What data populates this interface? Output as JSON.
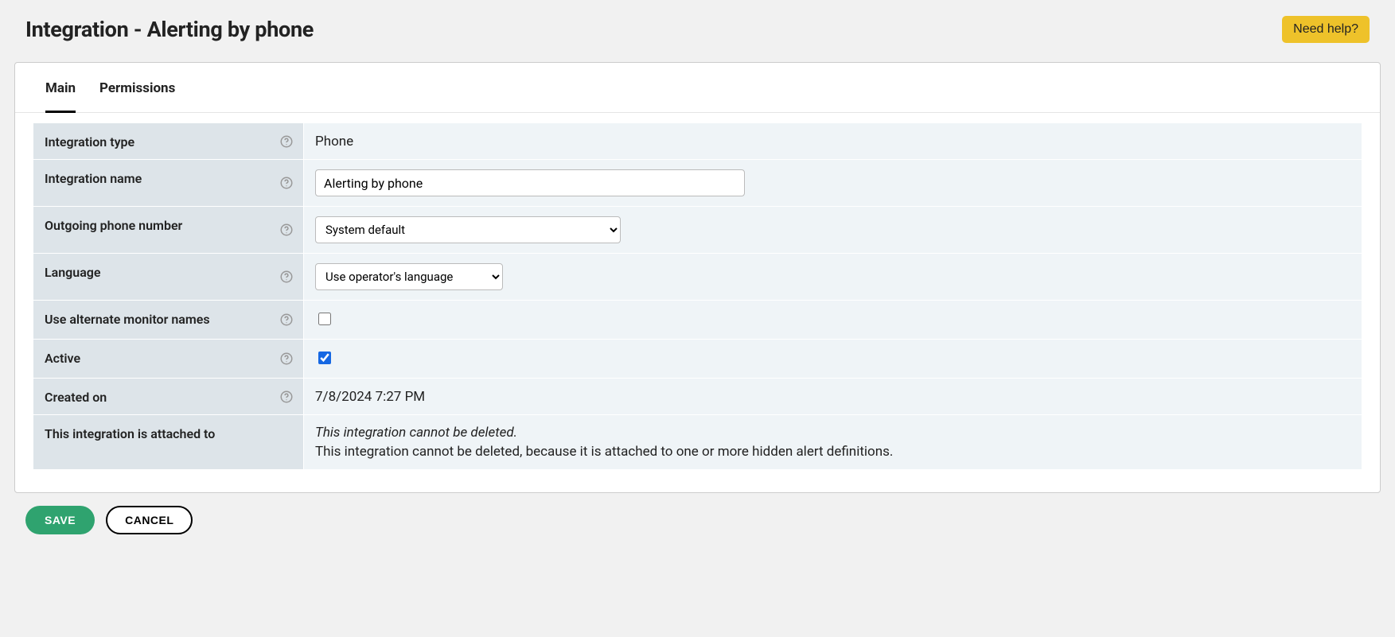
{
  "header": {
    "title": "Integration - Alerting by phone",
    "help_label": "Need help?"
  },
  "tabs": {
    "main": "Main",
    "permissions": "Permissions"
  },
  "form": {
    "integration_type": {
      "label": "Integration type",
      "value": "Phone"
    },
    "integration_name": {
      "label": "Integration name",
      "value": "Alerting by phone"
    },
    "outgoing_phone": {
      "label": "Outgoing phone number",
      "selected": "System default"
    },
    "language": {
      "label": "Language",
      "selected": "Use operator's language"
    },
    "alt_names": {
      "label": "Use alternate monitor names",
      "checked": false
    },
    "active": {
      "label": "Active",
      "checked": true
    },
    "created_on": {
      "label": "Created on",
      "value": "7/8/2024 7:27 PM"
    },
    "attached": {
      "label": "This integration is attached to",
      "italic": "This integration cannot be deleted.",
      "desc": "This integration cannot be deleted, because it is attached to one or more hidden alert definitions."
    }
  },
  "footer": {
    "save": "SAVE",
    "cancel": "CANCEL"
  }
}
